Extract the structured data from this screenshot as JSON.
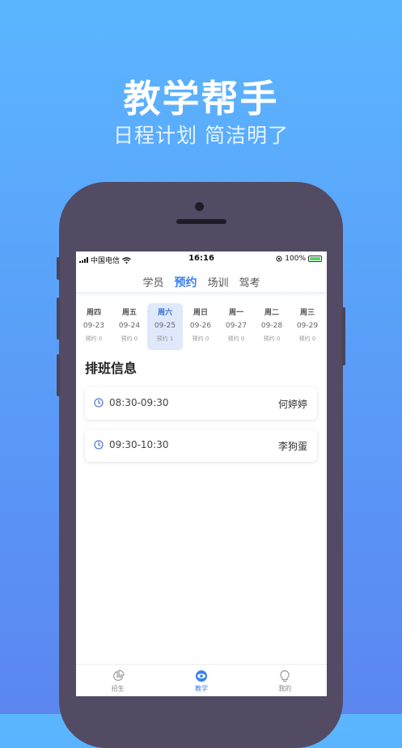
{
  "promo": {
    "headline": "教学帮手",
    "subline": "日程计划 简洁明了"
  },
  "statusbar": {
    "carrier": "中国电信",
    "time": "16:16",
    "battery": "100%"
  },
  "tabs": [
    {
      "label": "学员",
      "active": false
    },
    {
      "label": "预约",
      "active": true
    },
    {
      "label": "场训",
      "active": false
    },
    {
      "label": "驾考",
      "active": false
    }
  ],
  "days": [
    {
      "name": "周四",
      "date": "09-23",
      "count": "预约 0"
    },
    {
      "name": "周五",
      "date": "09-24",
      "count": "预约 0"
    },
    {
      "name": "周六",
      "date": "09-25",
      "count": "预约 1",
      "selected": true
    },
    {
      "name": "周日",
      "date": "09-26",
      "count": "预约 0"
    },
    {
      "name": "周一",
      "date": "09-27",
      "count": "预约 0"
    },
    {
      "name": "周二",
      "date": "09-28",
      "count": "预约 0"
    },
    {
      "name": "周三",
      "date": "09-29",
      "count": "预约 0"
    }
  ],
  "schedule": {
    "title": "排班信息",
    "items": [
      {
        "time": "08:30-09:30",
        "person": "何婷婷"
      },
      {
        "time": "09:30-10:30",
        "person": "李狗蛋"
      }
    ]
  },
  "bottom_nav": [
    {
      "label": "招生",
      "icon": "pie-chart-icon"
    },
    {
      "label": "教学",
      "icon": "eye-icon",
      "active": true
    },
    {
      "label": "我的",
      "icon": "lightbulb-icon"
    }
  ],
  "colors": {
    "accent": "#3a7ff2",
    "selected_day_bg": "#dfe9fb",
    "phone_body": "#524b63"
  }
}
